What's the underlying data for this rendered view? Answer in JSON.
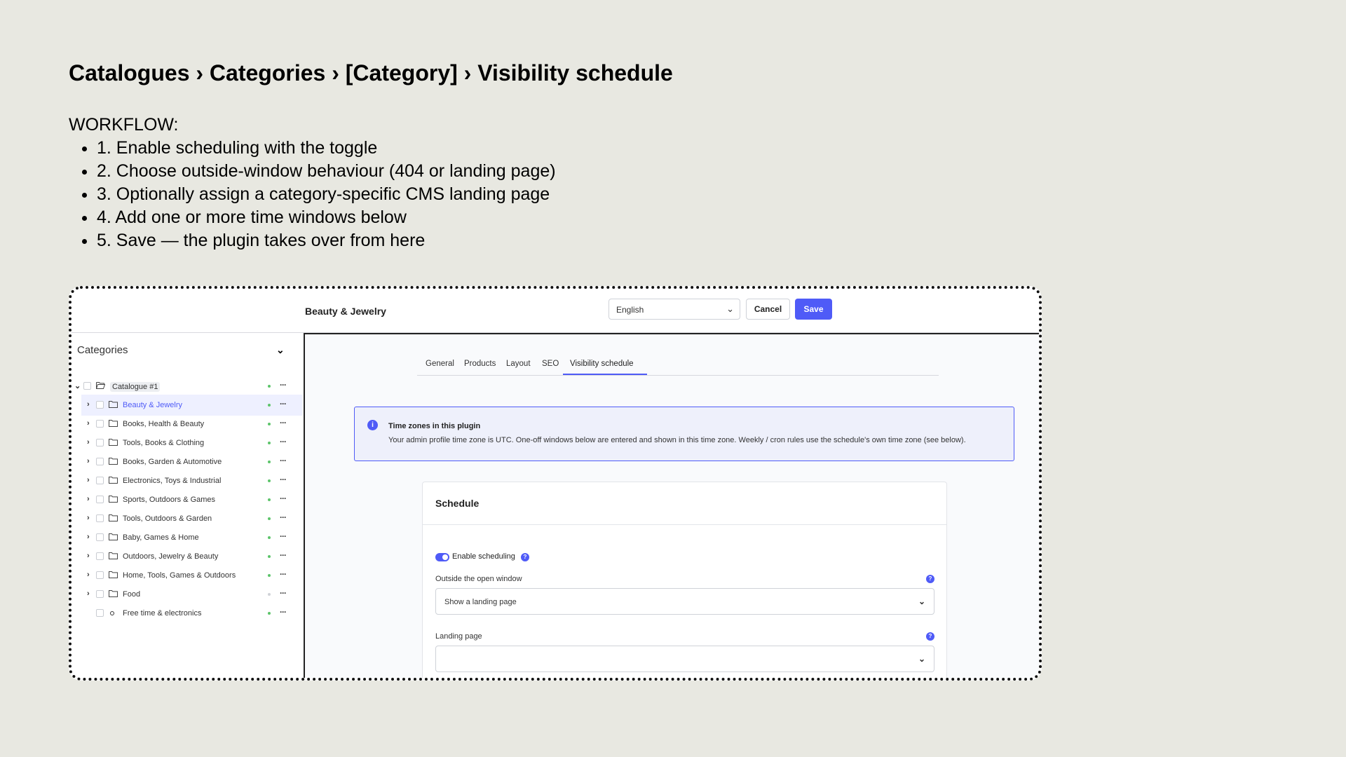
{
  "title": "Catalogues › Categories › [Category] › Visibility schedule",
  "workflow": {
    "heading": "WORKFLOW:",
    "steps": [
      "1. Enable scheduling with the toggle",
      "2. Choose outside-window behaviour (404 or landing page)",
      "3. Optionally assign a category-specific CMS landing page",
      "4. Add one or more time windows below",
      "5. Save — the plugin takes over from here"
    ]
  },
  "topbar": {
    "category_name": "Beauty & Jewelry",
    "language": "English",
    "cancel_label": "Cancel",
    "save_label": "Save"
  },
  "sidebar": {
    "heading": "Categories",
    "root": "Catalogue #1",
    "items": [
      {
        "label": "Beauty & Jewelry",
        "status": "active"
      },
      {
        "label": "Books, Health & Beauty",
        "status": "active"
      },
      {
        "label": "Tools, Books & Clothing",
        "status": "active"
      },
      {
        "label": "Books, Garden & Automotive",
        "status": "active"
      },
      {
        "label": "Electronics, Toys & Industrial",
        "status": "active"
      },
      {
        "label": "Sports, Outdoors & Games",
        "status": "active"
      },
      {
        "label": "Tools, Outdoors & Garden",
        "status": "active"
      },
      {
        "label": "Baby, Games & Home",
        "status": "active"
      },
      {
        "label": "Outdoors, Jewelry & Beauty",
        "status": "active"
      },
      {
        "label": "Home, Tools, Games & Outdoors",
        "status": "active"
      },
      {
        "label": "Food",
        "status": "inactive"
      },
      {
        "label": "Free time & electronics",
        "status": "active"
      }
    ]
  },
  "tabs": [
    "General",
    "Products",
    "Layout",
    "SEO",
    "Visibility schedule"
  ],
  "active_tab": "Visibility schedule",
  "info": {
    "title": "Time zones in this plugin",
    "text": "Your admin profile time zone is UTC. One-off windows below are entered and shown in this time zone. Weekly / cron rules use the schedule's own time zone (see below)."
  },
  "schedule": {
    "title": "Schedule",
    "toggle_label": "Enable scheduling",
    "outside_label": "Outside the open window",
    "outside_value": "Show a landing page",
    "landing_label": "Landing page",
    "landing_value": ""
  },
  "colors": {
    "accent": "#4f5bf7",
    "status_active": "#5cc46a",
    "status_inactive": "#d0d3d8",
    "background": "#e8e8e1"
  }
}
